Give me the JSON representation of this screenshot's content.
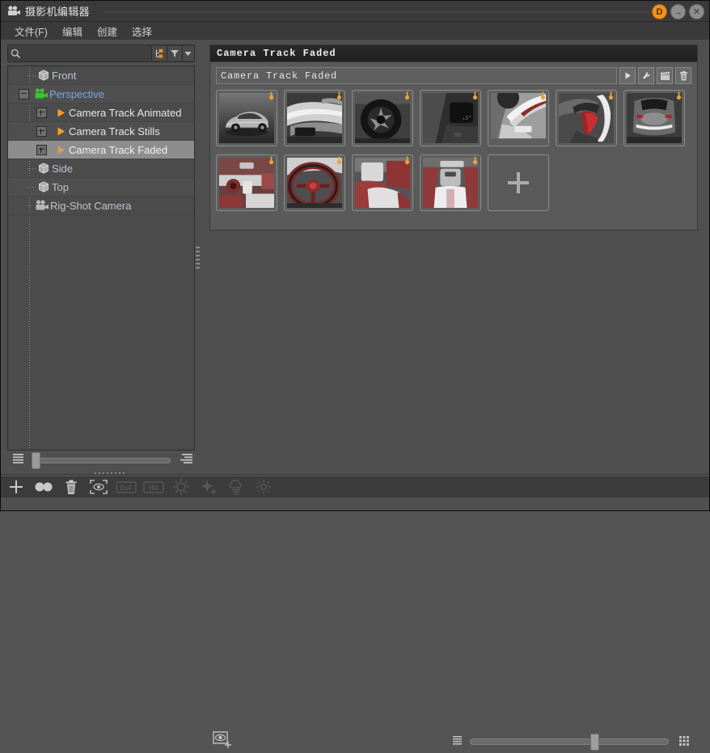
{
  "window": {
    "title": "摄影机编辑器",
    "icon": "camera-icon",
    "buttons": [
      {
        "name": "doc-button",
        "label": "D",
        "color": "#f0921e"
      },
      {
        "name": "minimize-button",
        "label": "→",
        "color": "#8d8d8d"
      },
      {
        "name": "close-button",
        "label": "✕",
        "color": "#8d8d8d"
      }
    ]
  },
  "menubar": {
    "items": [
      {
        "name": "menu-file",
        "label": "文件(F)"
      },
      {
        "name": "menu-edit",
        "label": "编辑"
      },
      {
        "name": "menu-create",
        "label": "创建"
      },
      {
        "name": "menu-select",
        "label": "选择"
      }
    ]
  },
  "search": {
    "placeholder": "",
    "value": "",
    "icon": "search-icon",
    "buttons": [
      {
        "name": "hierarchy-toggle-button",
        "icon": "hierarchy-icon",
        "color": "#f0921e"
      },
      {
        "name": "filter-button",
        "icon": "funnel-icon"
      },
      {
        "name": "filter-dropdown-button",
        "icon": "chevron-down-icon"
      }
    ]
  },
  "tree": {
    "items": [
      {
        "name": "tree-item-front",
        "label": "Front",
        "icon": "cube-icon",
        "indent": 1,
        "expander": "none",
        "selected": false,
        "kind": "view"
      },
      {
        "name": "tree-item-perspective",
        "label": "Perspective",
        "icon": "camera-green-icon",
        "indent": 0,
        "expander": "minus",
        "selected": false,
        "kind": "camera"
      },
      {
        "name": "tree-item-camera-track-animated",
        "label": "Camera Track Animated",
        "icon": "triangle-orange-icon",
        "indent": 2,
        "expander": "plus",
        "selected": false,
        "kind": "track"
      },
      {
        "name": "tree-item-camera-track-stills",
        "label": "Camera Track Stills",
        "icon": "triangle-orange-icon",
        "indent": 2,
        "expander": "plus",
        "selected": false,
        "kind": "track"
      },
      {
        "name": "tree-item-camera-track-faded",
        "label": "Camera Track Faded",
        "icon": "triangle-orange-faded-icon",
        "indent": 2,
        "expander": "plus",
        "selected": true,
        "kind": "track"
      },
      {
        "name": "tree-item-side",
        "label": "Side",
        "icon": "cube-icon",
        "indent": 1,
        "expander": "none",
        "selected": false,
        "kind": "view"
      },
      {
        "name": "tree-item-top",
        "label": "Top",
        "icon": "cube-icon",
        "indent": 1,
        "expander": "none",
        "selected": false,
        "kind": "view"
      },
      {
        "name": "tree-item-rig-shot-camera",
        "label": "Rig-Shot Camera",
        "icon": "camera-gray-icon",
        "indent": 1,
        "expander": "none",
        "selected": false,
        "kind": "camera"
      }
    ]
  },
  "left_footer": {
    "list_icon": "list-lines-icon",
    "align_icon": "align-right-lines-icon",
    "slider_value": 0,
    "grip": "resize-grip"
  },
  "panel": {
    "title": "Camera Track Faded",
    "name_field": {
      "value": "Camera Track Faded",
      "placeholder": ""
    },
    "toolbar": [
      {
        "name": "play-button",
        "icon": "play-icon"
      },
      {
        "name": "settings-button",
        "icon": "wrench-icon"
      },
      {
        "name": "clapperboard-button",
        "icon": "clapperboard-icon"
      },
      {
        "name": "delete-button",
        "icon": "trash-icon"
      }
    ],
    "shots": [
      {
        "name": "shot-thumbnail",
        "alt": "car-exterior-front-three-quarter",
        "badge": "key-icon"
      },
      {
        "name": "shot-thumbnail",
        "alt": "car-hood-closeup",
        "badge": "key-icon"
      },
      {
        "name": "shot-thumbnail",
        "alt": "wheel-rim-closeup",
        "badge": "key-icon"
      },
      {
        "name": "shot-thumbnail",
        "alt": "side-vent-dark-detail",
        "badge": "key-icon"
      },
      {
        "name": "shot-thumbnail",
        "alt": "headlight-white-detail",
        "badge": "key-icon"
      },
      {
        "name": "shot-thumbnail",
        "alt": "taillight-red-detail",
        "badge": "key-icon"
      },
      {
        "name": "shot-thumbnail",
        "alt": "car-rear-top-view",
        "badge": "key-icon"
      },
      {
        "name": "shot-thumbnail",
        "alt": "interior-dashboard",
        "badge": "key-icon"
      },
      {
        "name": "shot-thumbnail",
        "alt": "steering-wheel",
        "badge": "key-icon"
      },
      {
        "name": "shot-thumbnail",
        "alt": "seat-red-white",
        "badge": "key-icon"
      },
      {
        "name": "shot-thumbnail",
        "alt": "interior-center-console",
        "badge": "key-icon"
      }
    ],
    "add_tile": {
      "name": "add-shot-button",
      "icon": "plus-icon"
    }
  },
  "right_footer": {
    "camera_add_icon": "camera-add-icon",
    "list_icon": "list-lines-icon",
    "grid_icon": "grid-3x3-icon",
    "slider_value": 58
  },
  "bottom_toolbar": {
    "buttons": [
      {
        "name": "add-camera-button",
        "icon": "plus-icon",
        "dim": false
      },
      {
        "name": "duplicate-button",
        "icon": "two-circles-icon",
        "dim": false
      },
      {
        "name": "delete-button",
        "icon": "trash-icon",
        "dim": false
      },
      {
        "name": "focus-target-button",
        "icon": "focus-brackets-icon",
        "dim": false
      },
      {
        "name": "depth-of-field-button",
        "icon": "dof-badge-icon",
        "label": "DoF",
        "dim": true
      },
      {
        "name": "hd-button",
        "icon": "hd-badge-icon",
        "label": "HD",
        "dim": true
      },
      {
        "name": "brightness-button",
        "icon": "sun-icon",
        "dim": true
      },
      {
        "name": "sparkle-button",
        "icon": "sparkle-icon",
        "dim": true
      },
      {
        "name": "cloud-button",
        "icon": "cloud-icon",
        "dim": true
      },
      {
        "name": "sunlight-button",
        "icon": "small-sun-icon",
        "dim": true
      }
    ]
  }
}
